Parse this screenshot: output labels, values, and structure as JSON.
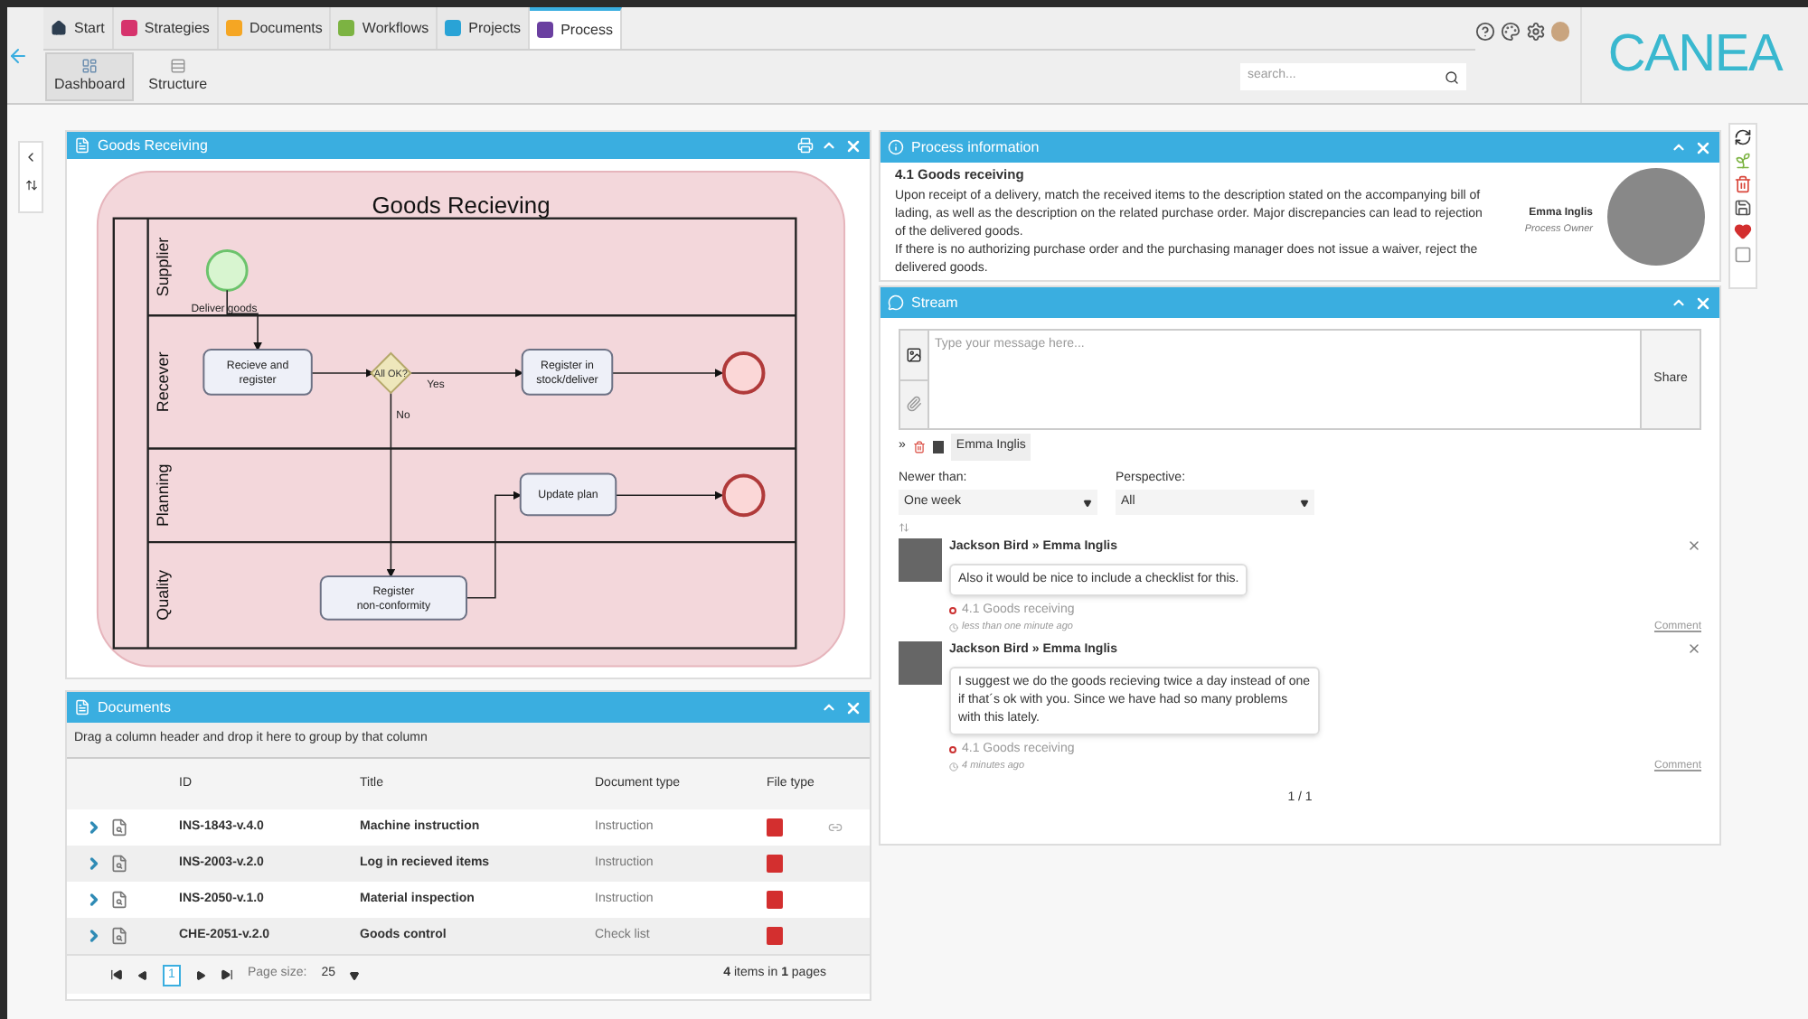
{
  "tabs": [
    {
      "label": "Start",
      "kind": "home",
      "selected": false
    },
    {
      "label": "Strategies",
      "kind": "tile",
      "color": "#d6336c",
      "selected": false
    },
    {
      "label": "Documents",
      "kind": "tile",
      "color": "#f5a623",
      "selected": false
    },
    {
      "label": "Workflows",
      "kind": "tile",
      "color": "#7cb342",
      "selected": false
    },
    {
      "label": "Projects",
      "kind": "tile",
      "color": "#29a3d6",
      "selected": false
    },
    {
      "label": "Process",
      "kind": "tile",
      "color": "#6a3fa0",
      "selected": true
    }
  ],
  "subtabs": [
    {
      "label": "Dashboard",
      "selected": true
    },
    {
      "label": "Structure",
      "selected": false
    }
  ],
  "search": {
    "placeholder": "search..."
  },
  "logo": "CANEA",
  "diagram_panel": {
    "title": "Goods Receiving",
    "diagram": {
      "title": "Goods Recieving",
      "lanes": [
        "Supplier",
        "Recever",
        "Planning",
        "Quality"
      ],
      "start_label": "Deliver goods",
      "tasks": [
        "Recieve and register",
        "Register in stock/deliver",
        "Update plan",
        "Register non-conformity"
      ],
      "gateway": "All OK?",
      "yes": "Yes",
      "no": "No"
    }
  },
  "documents": {
    "title": "Documents",
    "group_hint": "Drag a column header and drop it here to group by that column",
    "columns": [
      "ID",
      "Title",
      "Document type",
      "File type"
    ],
    "rows": [
      {
        "id": "INS-1843-v.4.0",
        "title": "Machine instruction",
        "type": "Instruction"
      },
      {
        "id": "INS-2003-v.2.0",
        "title": "Log in recieved items",
        "type": "Instruction"
      },
      {
        "id": "INS-2050-v.1.0",
        "title": "Material inspection",
        "type": "Instruction"
      },
      {
        "id": "CHE-2051-v.2.0",
        "title": "Goods control",
        "type": "Check list"
      }
    ],
    "pages": [
      {
        "label": "1",
        "selected": true
      }
    ],
    "page_size_label": "Page size:",
    "page_size": "25",
    "summary": "**4** items in **1** pages"
  },
  "process_info": {
    "title": "Process information",
    "heading": "4.1 Goods receiving",
    "text": "Upon receipt of a delivery, match the received items to the description stated on the accompanying bill of lading, as well as the description on the related purchase order. Major discrepancies can lead to rejection of the delivered goods.\nIf there is no authorizing purchase order and the purchasing manager does not issue a waiver, reject the delivered goods.",
    "owner": "Emma Inglis",
    "owner_role": "Process Owner"
  },
  "stream": {
    "title": "Stream",
    "placeholder": "Type your message here...",
    "share": "Share",
    "recipient_prefix": "»",
    "recipient": "Emma Inglis",
    "filters": [
      {
        "label": "Newer than:",
        "value": "One week"
      },
      {
        "label": "Perspective:",
        "value": "All"
      }
    ],
    "posts": [
      {
        "author": "Jackson Bird » Emma Inglis",
        "text": "Also it would be nice to include a checklist for this.",
        "link": "4.1 Goods receiving",
        "time": "less than one minute ago",
        "action": "Comment"
      },
      {
        "author": "Jackson Bird » Emma Inglis",
        "text": "I suggest we do the goods recieving twice a day instead of one if that´s ok with you. Since we have had so many problems with this lately.",
        "link": "4.1 Goods receiving",
        "time": "4 minutes ago",
        "action": "Comment"
      }
    ],
    "pager": "1 / 1"
  }
}
